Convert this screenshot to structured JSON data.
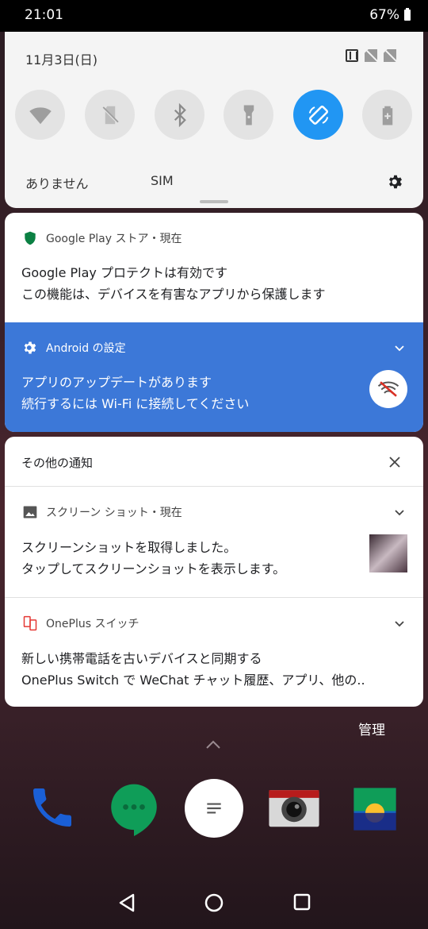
{
  "status_bar": {
    "time": "21:01",
    "battery": "67%"
  },
  "quick_settings": {
    "date": "11月3日(日)",
    "tiles": [
      "wifi-icon",
      "sim-off-icon",
      "bluetooth-icon",
      "flashlight-icon",
      "auto-rotate-icon",
      "battery-saver-icon"
    ],
    "label_left": "ありません",
    "label_sim": "SIM",
    "accent": "#2196f3"
  },
  "notifications": {
    "play": {
      "header": "Google Play ストア・現在",
      "title": "Google Play プロテクトは有効です",
      "text": "この機能は、デバイスを有害なアプリから保護します"
    },
    "android_settings": {
      "header": "Android の設定",
      "title": "アプリのアップデートがあります",
      "text": "続行するには Wi-Fi に接続してください",
      "bg": "#3c78d8"
    },
    "other": {
      "section_title": "その他の通知",
      "screenshot": {
        "header": "スクリーン ショット・現在",
        "title": "スクリーンショットを取得しました。",
        "text": "タップしてスクリーンショットを表示します。"
      },
      "oneplus": {
        "header": "OnePlus スイッチ",
        "title": "新しい携帯電話を古いデバイスと同期する",
        "text": "OnePlus Switch で WeChat チャット履歴、アプリ、他の.."
      }
    }
  },
  "manage_label": "管理"
}
